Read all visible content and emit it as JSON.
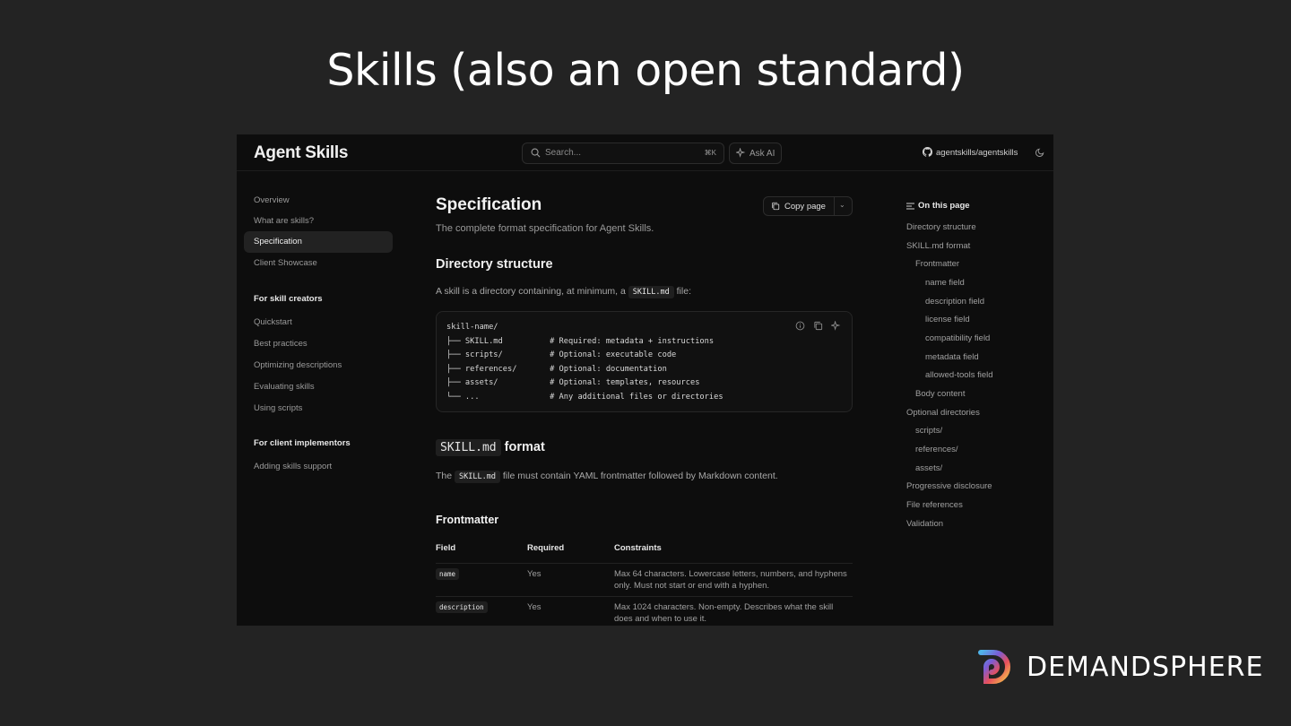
{
  "slide": {
    "title": "Skills (also an open standard)"
  },
  "header": {
    "brand": "Agent Skills",
    "search_placeholder": "Search...",
    "search_shortcut": "⌘K",
    "ask_ai": "Ask AI",
    "repo": "agentskills/agentskills"
  },
  "sidebar": {
    "items": [
      "Overview",
      "What are skills?",
      "Specification",
      "Client Showcase"
    ],
    "section1": {
      "title": "For skill creators",
      "items": [
        "Quickstart",
        "Best practices",
        "Optimizing descriptions",
        "Evaluating skills",
        "Using scripts"
      ]
    },
    "section2": {
      "title": "For client implementors",
      "items": [
        "Adding skills support"
      ]
    }
  },
  "main": {
    "title": "Specification",
    "subtitle": "The complete format specification for Agent Skills.",
    "copy_page": "Copy page",
    "dir_heading": "Directory structure",
    "dir_para_pre": "A skill is a directory containing, at minimum, a",
    "dir_para_code": "SKILL.md",
    "dir_para_post": "file:",
    "code_lines": [
      "skill-name/",
      "├── SKILL.md          # Required: metadata + instructions",
      "├── scripts/          # Optional: executable code",
      "├── references/       # Optional: documentation",
      "├── assets/           # Optional: templates, resources",
      "└── ...               # Any additional files or directories"
    ],
    "format_code": "SKILL.md",
    "format_heading": "format",
    "format_para_pre": "The",
    "format_para_code": "SKILL.md",
    "format_para_post": "file must contain YAML frontmatter followed by Markdown content.",
    "frontmatter_heading": "Frontmatter",
    "table": {
      "headers": [
        "Field",
        "Required",
        "Constraints"
      ],
      "rows": [
        {
          "field": "name",
          "required": "Yes",
          "constraints_1": "Max 64 characters. Lowercase letters, numbers, and hyphens",
          "constraints_2": "only. Must not start or end with a hyphen."
        },
        {
          "field": "description",
          "required": "Yes",
          "constraints_1": "Max 1024 characters. Non-empty. Describes what the skill",
          "constraints_2": "does and when to use it."
        }
      ]
    }
  },
  "toc": {
    "title": "On this page",
    "items": [
      "Directory structure",
      "SKILL.md format",
      "Frontmatter",
      "name field",
      "description field",
      "license field",
      "compatibility field",
      "metadata field",
      "allowed-tools field",
      "Body content",
      "Optional directories",
      "scripts/",
      "references/",
      "assets/",
      "Progressive disclosure",
      "File references",
      "Validation"
    ]
  },
  "footer": {
    "logo_text": "DEMANDSPHERE"
  },
  "colors": {
    "background": "#232323",
    "screenshot_bg": "#0d0d0d",
    "accent": "#ffffff"
  }
}
